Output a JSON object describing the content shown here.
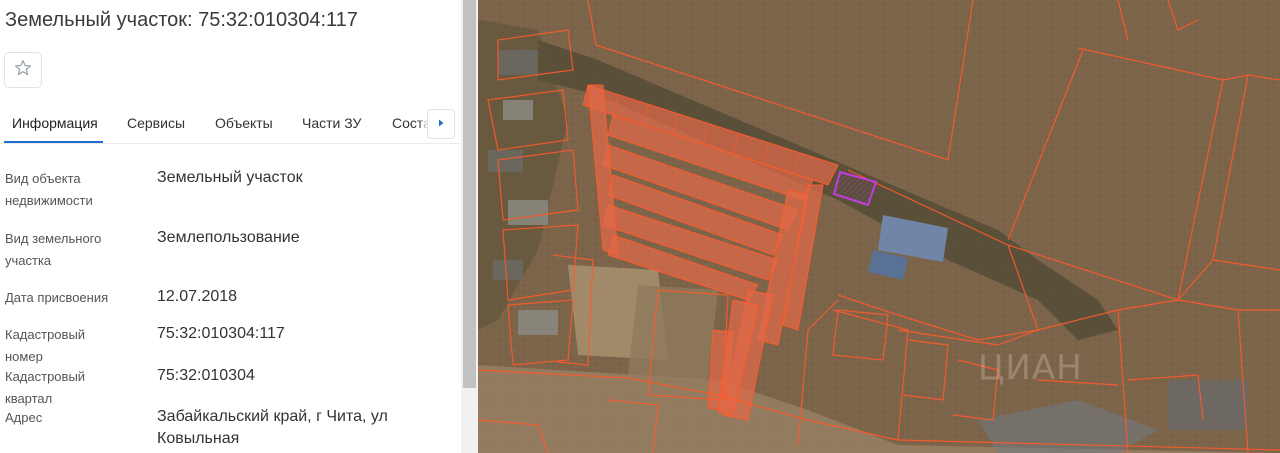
{
  "title": "Земельный участок: 75:32:010304:117",
  "favorite": {
    "icon": "star-outline-icon"
  },
  "tabs": [
    {
      "label": "Информация",
      "active": true
    },
    {
      "label": "Сервисы",
      "active": false
    },
    {
      "label": "Объекты",
      "active": false
    },
    {
      "label": "Части ЗУ",
      "active": false
    },
    {
      "label": "Состав",
      "active": false
    }
  ],
  "tabs_next_icon": "chevron-right-icon",
  "info": [
    {
      "label": "Вид объекта недвижимости",
      "value": "Земельный участок"
    },
    {
      "label": "Вид земельного участка",
      "value": "Землепользование"
    },
    {
      "label": "Дата присвоения",
      "value": "12.07.2018"
    },
    {
      "label": "Кадастровый номер",
      "value": "75:32:010304:117"
    },
    {
      "label": "Кадастровый квартал",
      "value": "75:32:010304"
    },
    {
      "label": "Адрес",
      "value": "Забайкальский край, г Чита, ул Ковыльная"
    }
  ],
  "map": {
    "watermark": "ЦИАН",
    "parcel_border_color": "#ff5a2a",
    "selected_parcel_color": "#c23ce0",
    "garage_fill_color": "#e0694a"
  },
  "colors": {
    "accent": "#1f6fd1"
  }
}
